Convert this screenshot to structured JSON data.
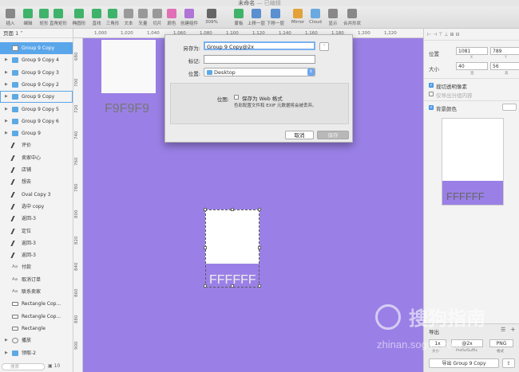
{
  "window": {
    "title": "未命名",
    "title_suffix": "— 已编辑"
  },
  "toolbar": {
    "items": [
      {
        "label": "插入",
        "icon": "plus-icon",
        "color": "#888"
      },
      {
        "label": "编辑",
        "icon": "edit-icon",
        "color": "#3fb36a"
      },
      {
        "label": "矩形",
        "icon": "rectangle-icon",
        "color": "#3fb36a"
      },
      {
        "label": "直角矩形",
        "icon": "rounded-rect-icon",
        "color": "#3fb36a"
      },
      {
        "label": "椭圆形",
        "icon": "oval-icon",
        "color": "#3fb36a"
      },
      {
        "label": "直线",
        "icon": "line-icon",
        "color": "#3fb36a"
      },
      {
        "label": "三角形",
        "icon": "triangle-icon",
        "color": "#3fb36a"
      },
      {
        "label": "文本",
        "icon": "text-icon",
        "color": "#999"
      },
      {
        "label": "矢量",
        "icon": "vector-icon",
        "color": "#999"
      },
      {
        "label": "切片",
        "icon": "slice-icon",
        "color": "#999"
      },
      {
        "label": "颜色",
        "icon": "color-wheel-icon",
        "color": "#e06fb5"
      },
      {
        "label": "创建组件",
        "icon": "component-icon",
        "color": "#b073d6"
      },
      {
        "label": "309%",
        "icon": "zoom-icon",
        "color": "#666"
      },
      {
        "label": "蒙板",
        "icon": "mask-icon",
        "color": "#3fb36a"
      },
      {
        "label": "上移一层",
        "icon": "forward-icon",
        "color": "#5a8fd0"
      },
      {
        "label": "下移一层",
        "icon": "backward-icon",
        "color": "#5a8fd0"
      },
      {
        "label": "Mirror",
        "icon": "mirror-icon",
        "color": "#e3a13a"
      },
      {
        "label": "Cloud",
        "icon": "cloud-icon",
        "color": "#6aa9e0"
      },
      {
        "label": "显示",
        "icon": "view-icon",
        "color": "#888"
      },
      {
        "label": "合并形状",
        "icon": "combine-icon",
        "color": "#888"
      }
    ]
  },
  "layers": {
    "page_label": "页面 1 ˅",
    "rows": [
      {
        "label": "Group 9 Copy",
        "icon": "artboard",
        "selected": true
      },
      {
        "label": "Group 9 Copy 4",
        "icon": "folder"
      },
      {
        "label": "Group 9 Copy 3",
        "icon": "folder"
      },
      {
        "label": "Group 9 Copy 2",
        "icon": "folder"
      },
      {
        "label": "Group 9 Copy",
        "icon": "folder",
        "boxed": true
      },
      {
        "label": "Group 9 Copy 5",
        "icon": "folder"
      },
      {
        "label": "Group 9 Copy 6",
        "icon": "folder"
      },
      {
        "label": "Group 9",
        "icon": "folder"
      },
      {
        "label": "评价",
        "icon": "pen"
      },
      {
        "label": "卖家中心",
        "icon": "pen"
      },
      {
        "label": "店铺",
        "icon": "pen"
      },
      {
        "label": "想去",
        "icon": "pen"
      },
      {
        "label": "Oval Copy 3",
        "icon": "pen"
      },
      {
        "label": "选中 copy",
        "icon": "pen"
      },
      {
        "label": "返回-3",
        "icon": "pen"
      },
      {
        "label": "定位",
        "icon": "pen"
      },
      {
        "label": "返回-3",
        "icon": "pen"
      },
      {
        "label": "返回-3",
        "icon": "pen"
      },
      {
        "label": "付款",
        "icon": "text"
      },
      {
        "label": "取消订单",
        "icon": "text"
      },
      {
        "label": "联系卖家",
        "icon": "text"
      },
      {
        "label": "Rectangle Cop...",
        "icon": "rect"
      },
      {
        "label": "Rectangle Cop...",
        "icon": "rect"
      },
      {
        "label": "Rectangle",
        "icon": "rect"
      },
      {
        "label": "播放",
        "icon": "group"
      },
      {
        "label": "领取-2",
        "icon": "folder"
      }
    ],
    "search_placeholder": "搜索",
    "bottom_count": "10"
  },
  "rulers": {
    "top": [
      "1,000",
      "1,020",
      "1,040",
      "1,060",
      "1,080",
      "1,100",
      "1,120",
      "1,140",
      "1,160",
      "1,180",
      "1,200",
      "1,220"
    ],
    "left": [
      "680",
      "700",
      "720",
      "740",
      "760",
      "780",
      "800",
      "820",
      "840",
      "860",
      "880",
      "900"
    ]
  },
  "canvas": {
    "label_top": "F9F9F9",
    "label_mid": "FFFFFF"
  },
  "dialog": {
    "save_as_label": "另存为:",
    "save_as_value": "Group 9 Copy@2x",
    "tags_label": "标记:",
    "location_label": "位置:",
    "location_value": "Desktop",
    "bitmap_label": "位图:",
    "web_format_label": "保存为 Web 格式",
    "note": "色彩配置文件和 EXIF 元数据将会被丢弃。",
    "cancel": "取消",
    "save": "保存"
  },
  "inspector": {
    "position_label": "位置",
    "x": "1081",
    "y": "789",
    "x_sub": "X",
    "y_sub": "Y",
    "size_label": "大小",
    "w": "40",
    "h": "56",
    "w_sub": "宽",
    "h_sub": "高",
    "clip_label": "裁切透明像素",
    "export_only_label": "仅导出分组内容",
    "bg_color_label": "背景颜色",
    "preview_label": "FFFFFF",
    "export_label": "导出",
    "scale_value": "1x",
    "scale_sub": "大小",
    "suffix_value": "@2x",
    "suffix_sub": "Prefix/Suffix",
    "format_value": "PNG",
    "format_sub": "格式",
    "export_button": "导出 Group 9 Copy"
  },
  "watermark": {
    "text": "搜狗指南",
    "url": "zhinan.sogou.com"
  }
}
